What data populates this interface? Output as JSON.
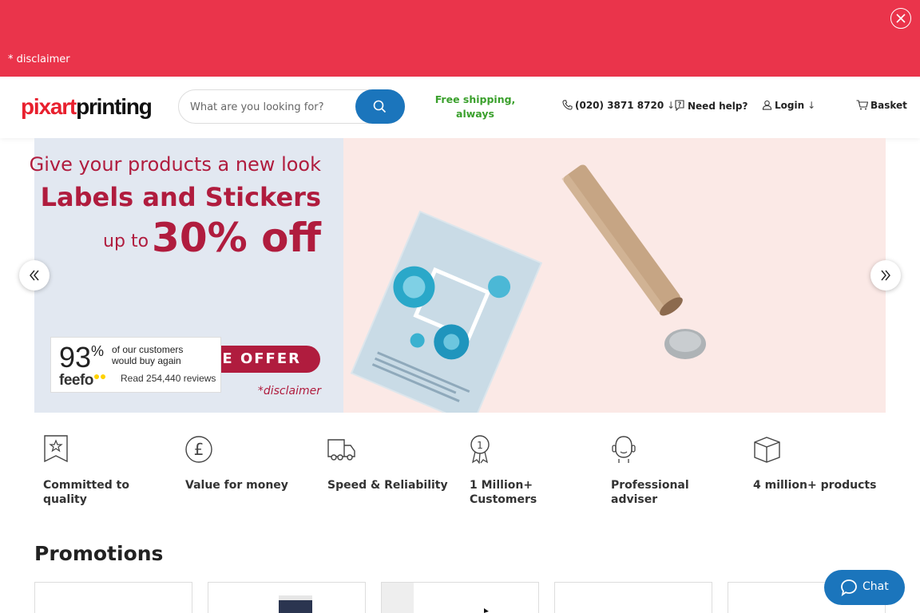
{
  "top_banner": {
    "disclaimer": "* disclaimer",
    "close_icon": "close-icon",
    "color": "#ea344b"
  },
  "header": {
    "logo_part1": "pixart",
    "logo_part2": "printing",
    "search_placeholder": "What are you looking for?",
    "free_shipping": "Free shipping, always",
    "phone": "(020) 3871 8720",
    "help": "Need help?",
    "login": "Login",
    "basket": "Basket",
    "arrow_down": "↓",
    "accent": "#1b75bc",
    "shipping_color": "#3aa02c"
  },
  "hero": {
    "tagline": "Give your products a new look",
    "headline": "Labels and Stickers",
    "discount_prefix": "up to",
    "discount": "30% off",
    "offer_button": "HE OFFER",
    "disclaimer": "*disclaimer",
    "brand_color": "#b01c3e"
  },
  "feefo": {
    "percent": "93",
    "percent_sign": "%",
    "line1": "of our customers",
    "line2": "would buy again",
    "brand": "feefo",
    "reviews": "Read 254,440 reviews"
  },
  "features": [
    {
      "label": "Committed to quality",
      "icon": "star-badge-icon"
    },
    {
      "label": "Value for money",
      "icon": "pound-icon"
    },
    {
      "label": "Speed & Reliability",
      "icon": "truck-icon"
    },
    {
      "label": "1 Million+ Customers",
      "icon": "medal-icon"
    },
    {
      "label": "Professional adviser",
      "icon": "adviser-icon"
    },
    {
      "label": "4 million+ products",
      "icon": "box-icon"
    }
  ],
  "promotions": {
    "title": "Promotions"
  },
  "chat": {
    "label": "Chat"
  }
}
